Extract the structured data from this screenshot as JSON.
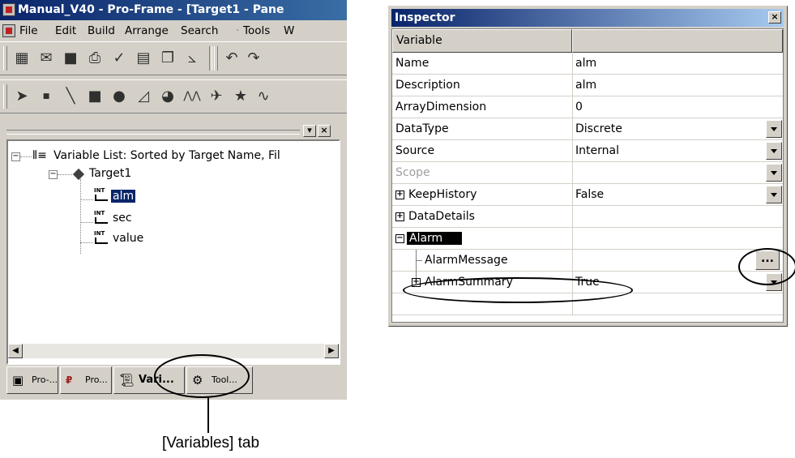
{
  "ide": {
    "title": "Manual_V40 - Pro-Frame - [Target1 - Pane",
    "menu": [
      "File",
      "Edit",
      "Build",
      "Arrange",
      "Search",
      "Tools",
      "W"
    ],
    "toolbar1_icons": [
      "build-icon",
      "open-icon",
      "save-icon",
      "print-icon",
      "check-icon",
      "calendar-icon",
      "copy-icon",
      "chart-icon",
      "undo-icon",
      "redo-icon"
    ],
    "toolbar2_icons": [
      "pointer-icon",
      "point-icon",
      "line-icon",
      "rectangle-icon",
      "ellipse-icon",
      "polygon-icon",
      "pie-icon",
      "polyline-icon",
      "freehand-icon",
      "star-icon",
      "bezier-icon"
    ],
    "tree": {
      "root_label": "Variable List: Sorted by Target Name, Fil",
      "target_label": "Target1",
      "variables": [
        {
          "type": "INT",
          "name": "alm",
          "selected": true
        },
        {
          "type": "INT",
          "name": "sec",
          "selected": false
        },
        {
          "type": "INT",
          "name": "value",
          "selected": false
        }
      ]
    },
    "tabs": [
      {
        "label": "Pro-...",
        "icon": "project-icon",
        "active": false
      },
      {
        "label": "Pro...",
        "icon": "proframe-icon",
        "active": false
      },
      {
        "label": "Vari...",
        "icon": "variables-icon",
        "active": true
      },
      {
        "label": "Tool...",
        "icon": "toolbox-icon",
        "active": false
      }
    ]
  },
  "callout": {
    "label": "[Variables] tab"
  },
  "inspector": {
    "title": "Inspector",
    "close_glyph": "×",
    "header": {
      "col1": "Variable",
      "col2": ""
    },
    "rows": [
      {
        "name": "Name",
        "value": "alm"
      },
      {
        "name": "Description",
        "value": "alm"
      },
      {
        "name": "ArrayDimension",
        "value": "0"
      },
      {
        "name": "DataType",
        "value": "Discrete"
      },
      {
        "name": "Source",
        "value": "Internal"
      },
      {
        "name": "Scope",
        "value": ""
      },
      {
        "name": "KeepHistory",
        "value": "False"
      },
      {
        "name": "DataDetails",
        "value": ""
      },
      {
        "name": "Alarm",
        "value": ""
      },
      {
        "name": "AlarmMessage",
        "value": ""
      },
      {
        "name": "AlarmSummary",
        "value": "True"
      },
      {
        "name": "",
        "value": ""
      }
    ],
    "ellipsis_label": "..."
  },
  "colors": {
    "title_active": "#0a246a",
    "face": "#d4d0c8",
    "selection": "#0a246a"
  }
}
